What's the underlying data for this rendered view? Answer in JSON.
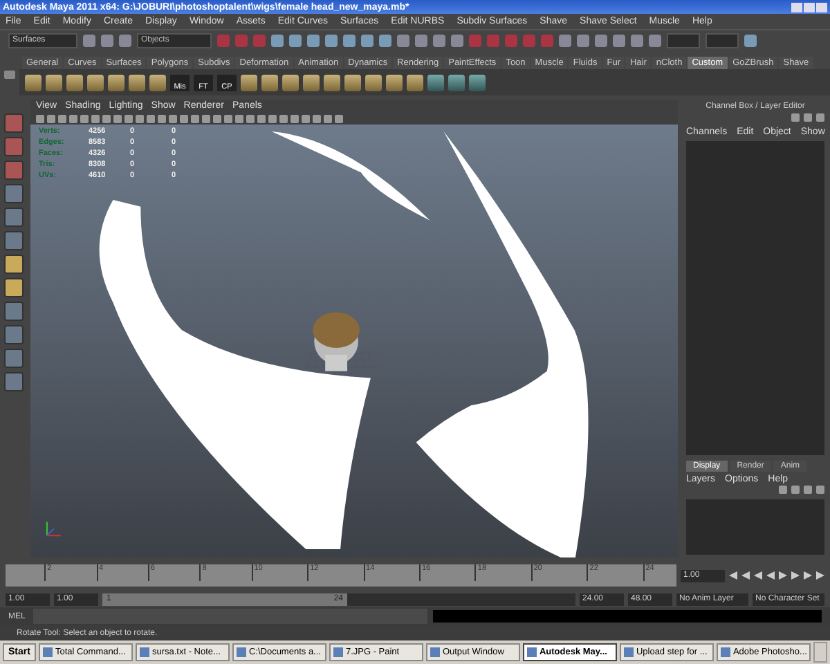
{
  "window": {
    "title": "Autodesk Maya 2011 x64: G:\\JOBURI\\photoshoptalent\\wigs\\female head_new_maya.mb*"
  },
  "menu": [
    "File",
    "Edit",
    "Modify",
    "Create",
    "Display",
    "Window",
    "Assets",
    "Edit Curves",
    "Surfaces",
    "Edit NURBS",
    "Subdiv Surfaces",
    "Shave",
    "Shave Select",
    "Muscle",
    "Help"
  ],
  "status_line": {
    "menu_set": "Surfaces",
    "selection_field": {
      "placeholder": "Objects"
    }
  },
  "shelf_tabs": [
    {
      "label": "General",
      "selected": false
    },
    {
      "label": "Curves",
      "selected": false
    },
    {
      "label": "Surfaces",
      "selected": false
    },
    {
      "label": "Polygons",
      "selected": false
    },
    {
      "label": "Subdivs",
      "selected": false
    },
    {
      "label": "Deformation",
      "selected": false
    },
    {
      "label": "Animation",
      "selected": false
    },
    {
      "label": "Dynamics",
      "selected": false
    },
    {
      "label": "Rendering",
      "selected": false
    },
    {
      "label": "PaintEffects",
      "selected": false
    },
    {
      "label": "Toon",
      "selected": false
    },
    {
      "label": "Muscle",
      "selected": false
    },
    {
      "label": "Fluids",
      "selected": false
    },
    {
      "label": "Fur",
      "selected": false
    },
    {
      "label": "Hair",
      "selected": false
    },
    {
      "label": "nCloth",
      "selected": false
    },
    {
      "label": "Custom",
      "selected": true
    },
    {
      "label": "GoZBrush",
      "selected": false
    },
    {
      "label": "Shave",
      "selected": false
    }
  ],
  "shelf_labels": [
    "Mis",
    "FT",
    "CP"
  ],
  "viewport": {
    "menu": [
      "View",
      "Shading",
      "Lighting",
      "Show",
      "Renderer",
      "Panels"
    ],
    "hud": [
      {
        "label": "Verts:",
        "values": [
          "4256",
          "0",
          "0"
        ]
      },
      {
        "label": "Edges:",
        "values": [
          "8583",
          "0",
          "0"
        ]
      },
      {
        "label": "Faces:",
        "values": [
          "4326",
          "0",
          "0"
        ]
      },
      {
        "label": "Tris:",
        "values": [
          "8308",
          "0",
          "0"
        ]
      },
      {
        "label": "UVs:",
        "values": [
          "4610",
          "0",
          "0"
        ]
      }
    ]
  },
  "channel_box": {
    "title": "Channel Box / Layer Editor",
    "menu": [
      "Channels",
      "Edit",
      "Object",
      "Show"
    ],
    "layer_tabs": [
      {
        "label": "Display",
        "selected": true
      },
      {
        "label": "Render",
        "selected": false
      },
      {
        "label": "Anim",
        "selected": false
      }
    ],
    "layer_menu": [
      "Layers",
      "Options",
      "Help"
    ]
  },
  "timeline": {
    "ticks": [
      "2",
      "4",
      "6",
      "8",
      "10",
      "12",
      "14",
      "16",
      "18",
      "20",
      "22",
      "24"
    ],
    "current_frame": "1.00"
  },
  "range": {
    "level": 0.5,
    "start": "1.00",
    "playback_start": "1.00",
    "slider_start": "1",
    "slider_end": "24",
    "playback_end": "24.00",
    "end": "48.00",
    "anim_layer": "No Anim Layer",
    "character_set": "No Character Set"
  },
  "command_line": {
    "label": "MEL"
  },
  "help_line": "Rotate Tool: Select an object to rotate.",
  "taskbar": {
    "start": "Start",
    "items": [
      {
        "label": "Total Command...",
        "selected": false
      },
      {
        "label": "sursa.txt - Note...",
        "selected": false
      },
      {
        "label": "C:\\Documents a...",
        "selected": false
      },
      {
        "label": "7.JPG - Paint",
        "selected": false
      },
      {
        "label": "Output Window",
        "selected": false
      },
      {
        "label": "Autodesk May...",
        "selected": true
      },
      {
        "label": "Upload step for ...",
        "selected": false
      },
      {
        "label": "Adobe Photosho...",
        "selected": false
      }
    ]
  }
}
